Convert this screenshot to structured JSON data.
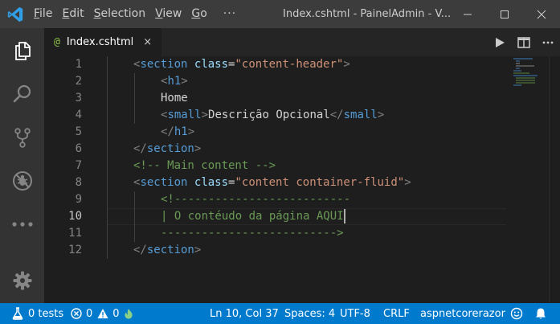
{
  "titlebar": {
    "menu": [
      "File",
      "Edit",
      "Selection",
      "View",
      "Go"
    ],
    "menu_underline": [
      "F",
      "E",
      "S",
      "V",
      "G"
    ],
    "menu_rest": [
      "ile",
      "dit",
      "election",
      "iew",
      "o"
    ],
    "more": "···",
    "title": "Index.cshtml - PainelAdmin - V..."
  },
  "tab": {
    "icon": "@",
    "label": "Index.cshtml",
    "close": "×"
  },
  "editor": {
    "line_numbers": [
      "1",
      "2",
      "3",
      "4",
      "5",
      "6",
      "7",
      "8",
      "9",
      "10",
      "11",
      "12"
    ],
    "active_line": "10",
    "lines": {
      "l1": {
        "lt": "<",
        "tag": "section",
        "attr": "class",
        "eq": "=",
        "val": "\"content-header\"",
        "gt": ">"
      },
      "l2": {
        "lt": "<",
        "tag": "h1",
        "gt": ">"
      },
      "l3": {
        "text": "Home"
      },
      "l4": {
        "lt": "<",
        "tag": "small",
        "gt": ">",
        "text": "Descrição Opcional",
        "lt2": "</",
        "tag2": "small",
        "gt2": ">"
      },
      "l5": {
        "lt": "</",
        "tag": "h1",
        "gt": ">"
      },
      "l6": {
        "lt": "</",
        "tag": "section",
        "gt": ">"
      },
      "l7": {
        "comment": "<!-- Main content -->"
      },
      "l8": {
        "lt": "<",
        "tag": "section",
        "attr": "class",
        "eq": "=",
        "val": "\"content container-fluid\"",
        "gt": ">"
      },
      "l9": {
        "comment": "<!--------------------------"
      },
      "l10": {
        "comment": "| O contéudo da página AQUI"
      },
      "l11": {
        "comment": "-------------------------->"
      },
      "l12": {
        "lt": "</",
        "tag": "section",
        "gt": ">"
      }
    }
  },
  "statusbar": {
    "tests": "0 tests",
    "errors": "0",
    "warnings": "0",
    "position": "Ln 10, Col 37",
    "spaces": "Spaces: 4",
    "encoding": "UTF-8",
    "eol": "CRLF",
    "project": "aspnetcorerazor"
  },
  "colors": {
    "statusbar": "#007acc",
    "titlebar": "#3c3c3c",
    "activitybar": "#333333",
    "editor": "#1e1e1e",
    "tag": "#569cd6",
    "attribute": "#9cdcfe",
    "string": "#ce9178",
    "comment": "#6a9955"
  }
}
